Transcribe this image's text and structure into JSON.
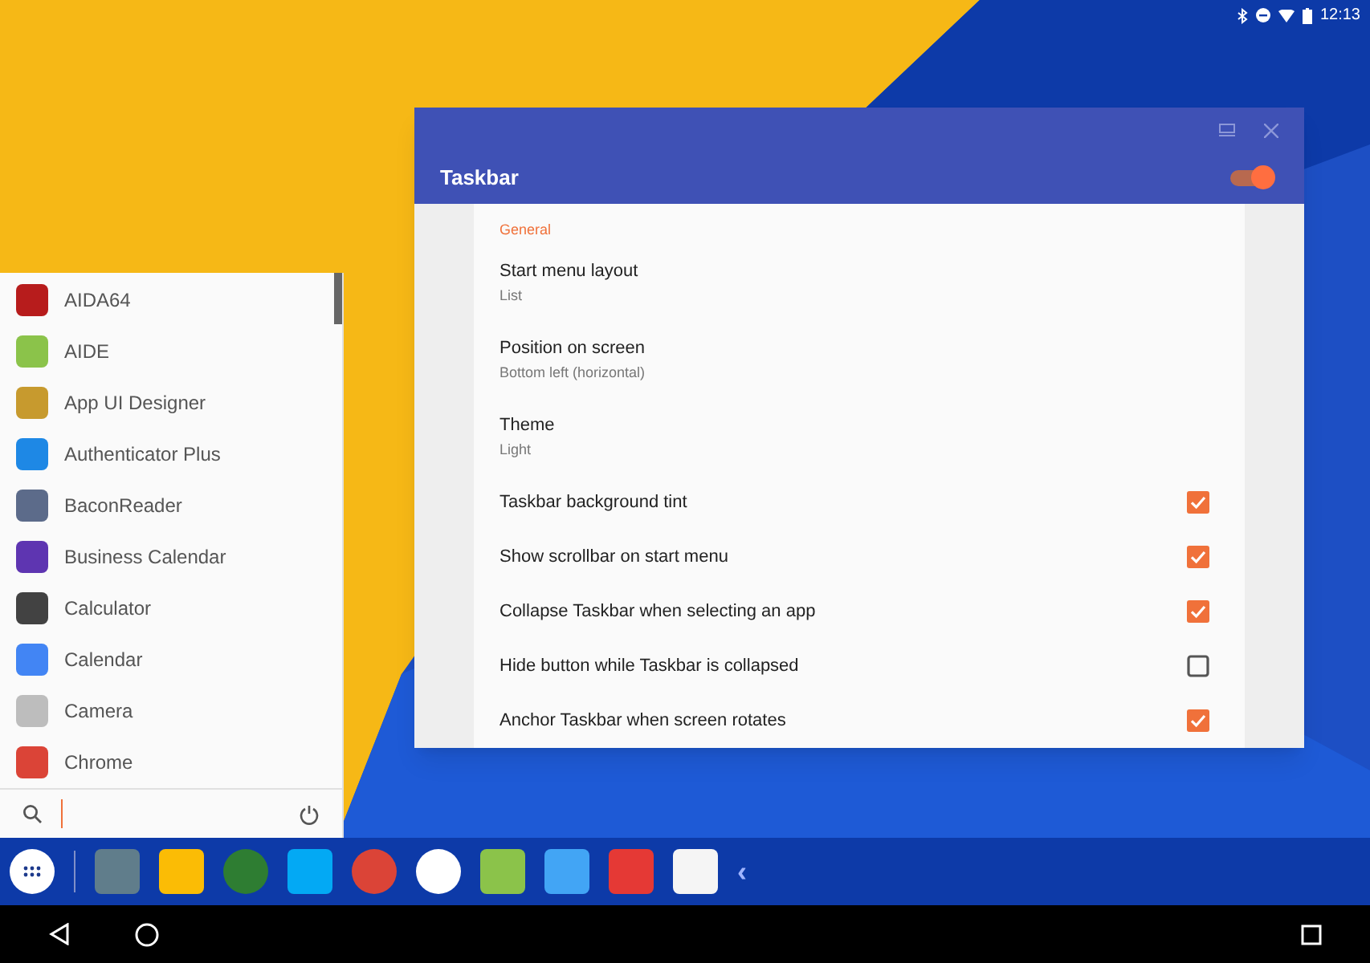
{
  "status_bar": {
    "time": "12:13"
  },
  "start_menu": {
    "apps": [
      {
        "name": "AIDA64",
        "color": "#b71c1c"
      },
      {
        "name": "AIDE",
        "color": "#8bc34a"
      },
      {
        "name": "App UI Designer",
        "color": "#c79a2e"
      },
      {
        "name": "Authenticator Plus",
        "color": "#1e88e5"
      },
      {
        "name": "BaconReader",
        "color": "#5c6b8a"
      },
      {
        "name": "Business Calendar",
        "color": "#5e35b1"
      },
      {
        "name": "Calculator",
        "color": "#424242"
      },
      {
        "name": "Calendar",
        "color": "#4285f4"
      },
      {
        "name": "Camera",
        "color": "#bdbdbd"
      },
      {
        "name": "Chrome",
        "color": "#db4437"
      }
    ]
  },
  "settings_window": {
    "title": "Taskbar",
    "toggle_on": true,
    "section": "General",
    "items": [
      {
        "kind": "choice",
        "title": "Start menu layout",
        "summary": "List"
      },
      {
        "kind": "choice",
        "title": "Position on screen",
        "summary": "Bottom left (horizontal)"
      },
      {
        "kind": "choice",
        "title": "Theme",
        "summary": "Light"
      },
      {
        "kind": "checkbox",
        "title": "Taskbar background tint",
        "checked": true
      },
      {
        "kind": "checkbox",
        "title": "Show scrollbar on start menu",
        "checked": true
      },
      {
        "kind": "checkbox",
        "title": "Collapse Taskbar when selecting an app",
        "checked": true
      },
      {
        "kind": "checkbox",
        "title": "Hide button while Taskbar is collapsed",
        "checked": false
      },
      {
        "kind": "checkbox",
        "title": "Anchor Taskbar when screen rotates",
        "checked": true
      }
    ]
  },
  "taskbar": {
    "collapse_glyph": "‹",
    "apps": [
      {
        "color": "#607d8b"
      },
      {
        "color": "#fbbc05"
      },
      {
        "color": "#2e7d32"
      },
      {
        "color": "#03a9f4"
      },
      {
        "color": "#db4437"
      },
      {
        "color": "#ffffff"
      },
      {
        "color": "#8bc34a"
      },
      {
        "color": "#42a5f5"
      },
      {
        "color": "#e53935"
      },
      {
        "color": "#f5f5f5"
      }
    ]
  }
}
